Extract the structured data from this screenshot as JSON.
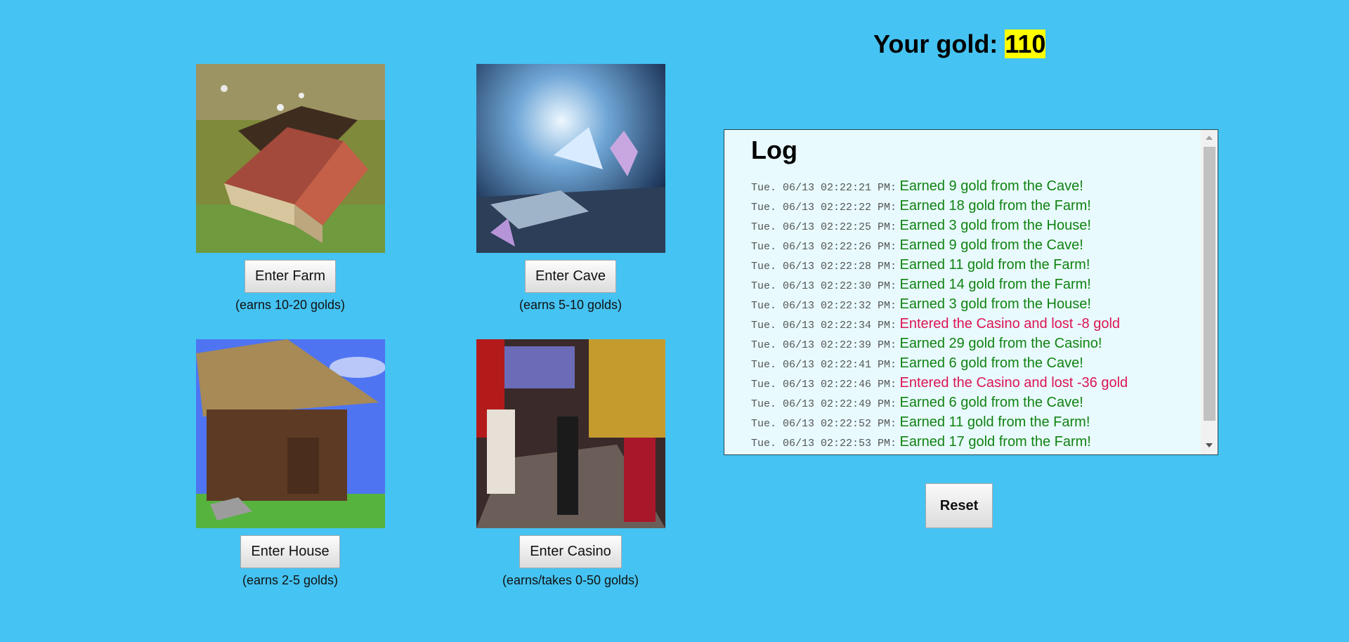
{
  "locations": [
    {
      "button_label": "Enter Farm",
      "earn_text": "(earns 10-20 golds)",
      "image_icon": "farm-image"
    },
    {
      "button_label": "Enter Cave",
      "earn_text": "(earns 5-10 golds)",
      "image_icon": "cave-image"
    },
    {
      "button_label": "Enter House",
      "earn_text": "(earns 2-5 golds)",
      "image_icon": "house-image"
    },
    {
      "button_label": "Enter Casino",
      "earn_text": "(earns/takes 0-50 golds)",
      "image_icon": "casino-image"
    }
  ],
  "gold": {
    "label": "Your gold: ",
    "value": "110",
    "highlight_color": "#ffff00"
  },
  "log": {
    "title": "Log",
    "entries": [
      {
        "time": "Tue. 06/13 02:22:21 PM:",
        "message": "Earned 9 gold from the Cave!",
        "type": "gain"
      },
      {
        "time": "Tue. 06/13 02:22:22 PM:",
        "message": "Earned 18 gold from the Farm!",
        "type": "gain"
      },
      {
        "time": "Tue. 06/13 02:22:25 PM:",
        "message": "Earned 3 gold from the House!",
        "type": "gain"
      },
      {
        "time": "Tue. 06/13 02:22:26 PM:",
        "message": "Earned 9 gold from the Cave!",
        "type": "gain"
      },
      {
        "time": "Tue. 06/13 02:22:28 PM:",
        "message": "Earned 11 gold from the Farm!",
        "type": "gain"
      },
      {
        "time": "Tue. 06/13 02:22:30 PM:",
        "message": "Earned 14 gold from the Farm!",
        "type": "gain"
      },
      {
        "time": "Tue. 06/13 02:22:32 PM:",
        "message": "Earned 3 gold from the House!",
        "type": "gain"
      },
      {
        "time": "Tue. 06/13 02:22:34 PM:",
        "message": "Entered the Casino and lost -8 gold",
        "type": "loss"
      },
      {
        "time": "Tue. 06/13 02:22:39 PM:",
        "message": "Earned 29 gold from the Casino!",
        "type": "gain"
      },
      {
        "time": "Tue. 06/13 02:22:41 PM:",
        "message": "Earned 6 gold from the Cave!",
        "type": "gain"
      },
      {
        "time": "Tue. 06/13 02:22:46 PM:",
        "message": "Entered the Casino and lost -36 gold",
        "type": "loss"
      },
      {
        "time": "Tue. 06/13 02:22:49 PM:",
        "message": "Earned 6 gold from the Cave!",
        "type": "gain"
      },
      {
        "time": "Tue. 06/13 02:22:52 PM:",
        "message": "Earned 11 gold from the Farm!",
        "type": "gain"
      },
      {
        "time": "Tue. 06/13 02:22:53 PM:",
        "message": "Earned 17 gold from the Farm!",
        "type": "gain"
      }
    ]
  },
  "reset": {
    "label": "Reset"
  },
  "colors": {
    "background": "#45c3f2",
    "gain": "#118211",
    "loss": "#dc1452",
    "log_background": "#e8fafe"
  }
}
